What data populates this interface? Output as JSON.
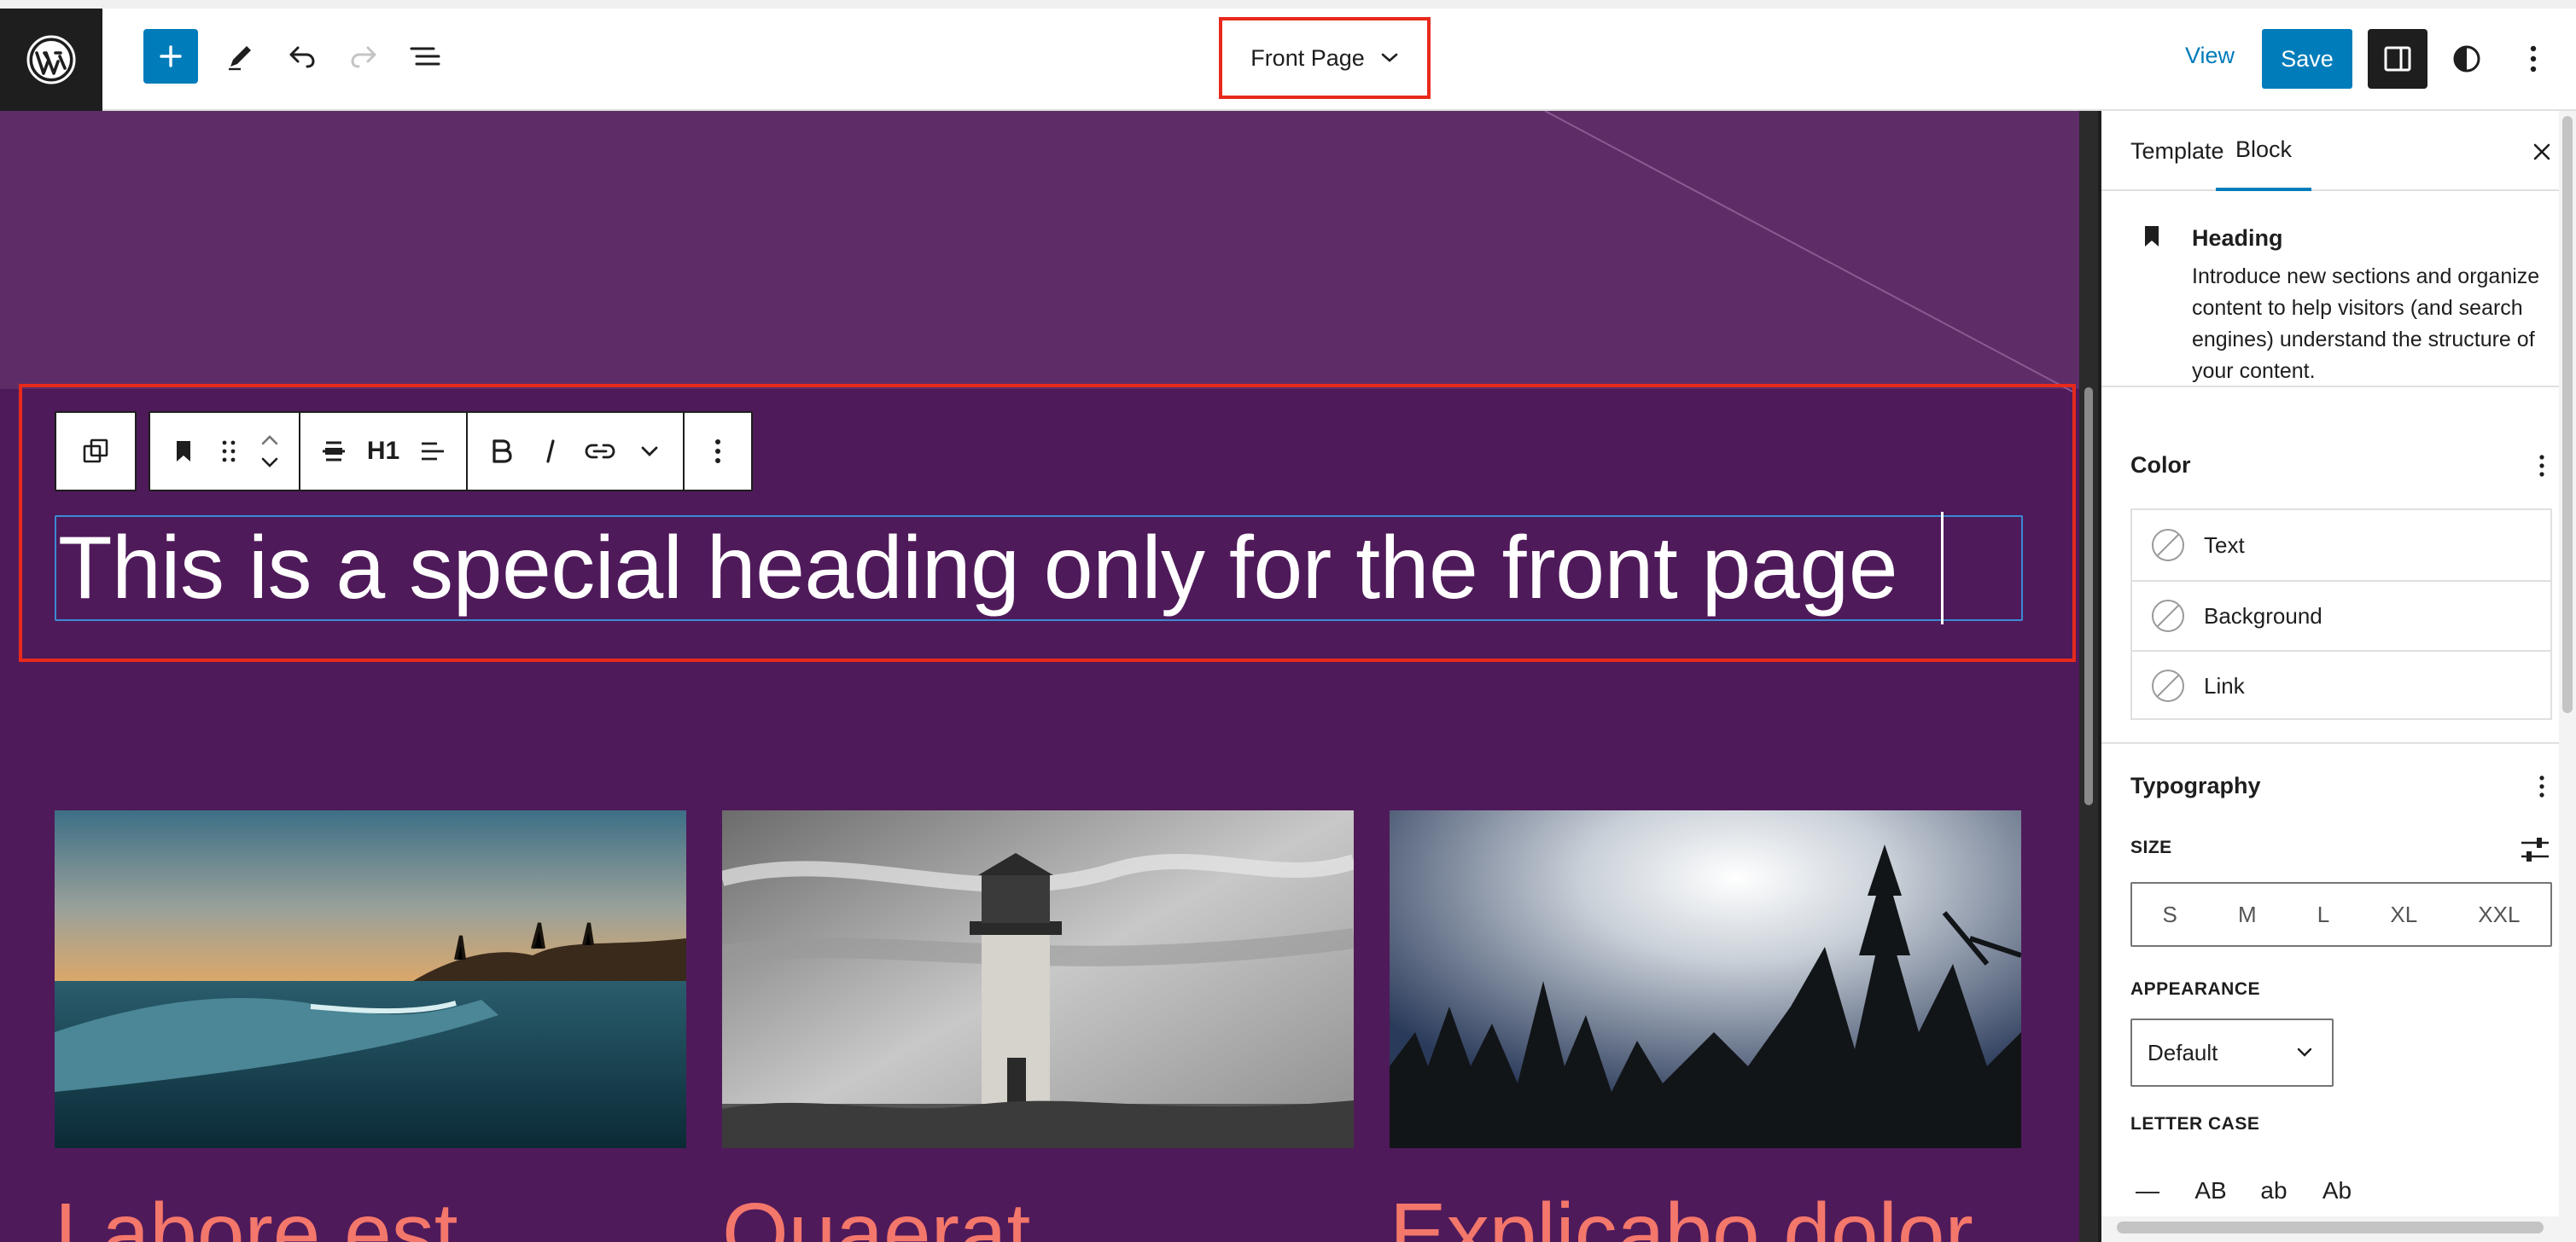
{
  "topbar": {
    "document_title": "Front Page",
    "view_label": "View",
    "save_label": "Save"
  },
  "canvas": {
    "heading_text": "This is a special heading only for the front page",
    "block_toolbar": {
      "heading_level": "H1"
    },
    "posts": [
      {
        "title": "Labore est",
        "image": "ocean-wave-coast"
      },
      {
        "title": "Quaerat",
        "image": "lighthouse-bw"
      },
      {
        "title": "Explicabo dolor",
        "image": "forest-silhouette"
      }
    ]
  },
  "sidebar": {
    "tabs": [
      {
        "label": "Template",
        "active": false
      },
      {
        "label": "Block",
        "active": true
      }
    ],
    "block_card": {
      "title": "Heading",
      "description": "Introduce new sections and organize content to help visitors (and search engines) understand the structure of your content."
    },
    "color": {
      "heading": "Color",
      "items": [
        {
          "label": "Text"
        },
        {
          "label": "Background"
        },
        {
          "label": "Link"
        }
      ]
    },
    "typography": {
      "heading": "Typography",
      "size_label": "SIZE",
      "sizes": [
        "S",
        "M",
        "L",
        "XL",
        "XXL"
      ],
      "appearance_label": "APPEARANCE",
      "appearance_value": "Default",
      "letter_case_label": "LETTER CASE",
      "letter_cases": [
        "—",
        "AB",
        "ab",
        "Ab"
      ]
    }
  },
  "colors": {
    "accent": "#007cba",
    "canvas_bg": "#4f1a5a",
    "canvas_top": "#5e2d67",
    "highlight": "#e8291c",
    "post_title": "#f4776b"
  }
}
